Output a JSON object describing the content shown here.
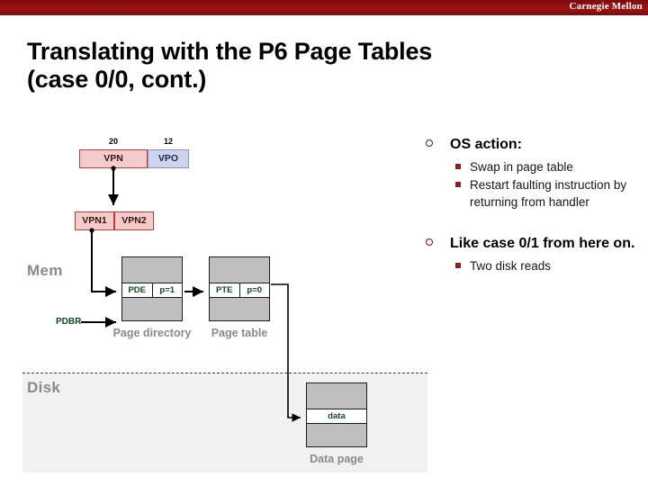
{
  "banner": {
    "label": "Carnegie Mellon"
  },
  "title": {
    "line1": "Translating with the P6 Page Tables",
    "line2": "(case 0/0, cont.)"
  },
  "bullets": [
    {
      "label": "OS action:",
      "marker": "hollow-circle",
      "sub": [
        {
          "label": "Swap in page table",
          "marker": "filled-square"
        },
        {
          "label": "Restart faulting instruction by returning from handler",
          "marker": "filled-square"
        }
      ]
    },
    {
      "label": "Like case 0/1 from here on.",
      "marker": "hollow-circle",
      "sub": [
        {
          "label": "Two disk reads",
          "marker": "filled-square"
        }
      ]
    }
  ],
  "diagram": {
    "regions": {
      "mem": "Mem",
      "disk": "Disk"
    },
    "bit_labels": {
      "vpn_bits": "20",
      "vpo_bits": "12"
    },
    "address_boxes": {
      "vpn": "VPN",
      "vpo": "VPO",
      "vpn1": "VPN1",
      "vpn2": "VPN2"
    },
    "page_directory": {
      "caption": "Page directory",
      "entry_name": "PDE",
      "entry_flag": "p=1"
    },
    "page_table": {
      "caption": "Page table",
      "entry_name": "PTE",
      "entry_flag": "p=0"
    },
    "data_page": {
      "caption": "Data page",
      "entry_name": "data"
    },
    "pdbr_label": "PDBR",
    "colors": {
      "banner": "#8c1010",
      "vpn_fill": "#f4cbcb",
      "vpn_border": "#c23b3b",
      "vpo_fill": "#cdd4ee",
      "page_fill": "#bfbfbf",
      "entry_text": "#0d4a1e",
      "region_label": "#8a8a8a",
      "disk_band": "#f1f1f1",
      "bullet_marker": "#7d0b0b"
    }
  }
}
